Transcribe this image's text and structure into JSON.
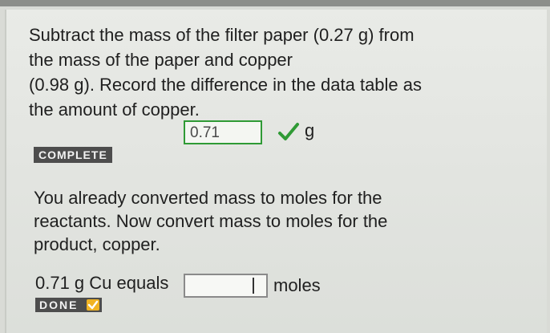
{
  "question": {
    "prompt_lines": [
      "Subtract the mass of the filter paper (0.27 g) from",
      "the mass of the paper and copper",
      "(0.98 g). Record the difference in the data table as",
      "the amount of copper."
    ],
    "answer_value": "0.71",
    "unit": "g",
    "status": "COMPLETE"
  },
  "next_question": {
    "info_lines": [
      "You already converted mass to moles for the",
      "reactants. Now convert mass to moles for the",
      "product, copper."
    ],
    "prefix": "0.71 g Cu equals",
    "input_value": "",
    "unit": "moles",
    "button_label": "DONE"
  },
  "colors": {
    "correct_border": "#2f9a35",
    "done_check": "#f0b323",
    "badge_bg": "#4d4d4d"
  },
  "icons": {
    "correct": "check-icon",
    "done": "check-icon"
  }
}
